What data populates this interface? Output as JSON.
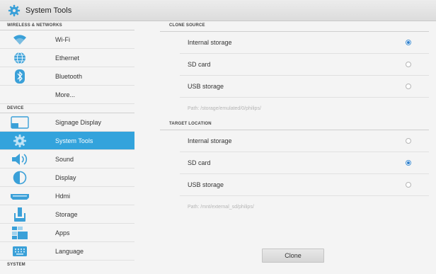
{
  "titlebar": {
    "title": "System Tools",
    "icon": "gear-icon"
  },
  "sidebar": {
    "sections": [
      {
        "header": "WIRELESS & NETWORKS"
      },
      {
        "header": "DEVICE"
      },
      {
        "header": "SYSTEM"
      }
    ],
    "items": [
      {
        "label": "Wi-Fi",
        "icon": "wifi-icon"
      },
      {
        "label": "Ethernet",
        "icon": "globe-icon"
      },
      {
        "label": "Bluetooth",
        "icon": "bluetooth-icon"
      },
      {
        "label": "More...",
        "icon": ""
      },
      {
        "label": "Signage Display",
        "icon": "display-screen-icon"
      },
      {
        "label": "System Tools",
        "icon": "gear-icon",
        "selected": true
      },
      {
        "label": "Sound",
        "icon": "speaker-icon"
      },
      {
        "label": "Display",
        "icon": "brightness-icon"
      },
      {
        "label": "Hdmi",
        "icon": "hdmi-icon"
      },
      {
        "label": "Storage",
        "icon": "storage-icon"
      },
      {
        "label": "Apps",
        "icon": "apps-icon"
      },
      {
        "label": "Language",
        "icon": "keyboard-icon"
      }
    ]
  },
  "clone_source": {
    "header": "CLONE SOURCE",
    "options": [
      {
        "label": "Internal storage",
        "selected": true
      },
      {
        "label": "SD card",
        "selected": false
      },
      {
        "label": "USB storage",
        "selected": false
      }
    ],
    "path": "Path: /storage/emulated/0/philips/"
  },
  "target_location": {
    "header": "TARGET LOCATION",
    "options": [
      {
        "label": "Internal storage",
        "selected": false
      },
      {
        "label": "SD card",
        "selected": true
      },
      {
        "label": "USB storage",
        "selected": false
      }
    ],
    "path": "Path: /mnt/external_sd/philips/"
  },
  "clone_button": {
    "label": "Clone"
  },
  "colors": {
    "accent": "#33a3dc",
    "radio_on": "#2f7fcc"
  }
}
